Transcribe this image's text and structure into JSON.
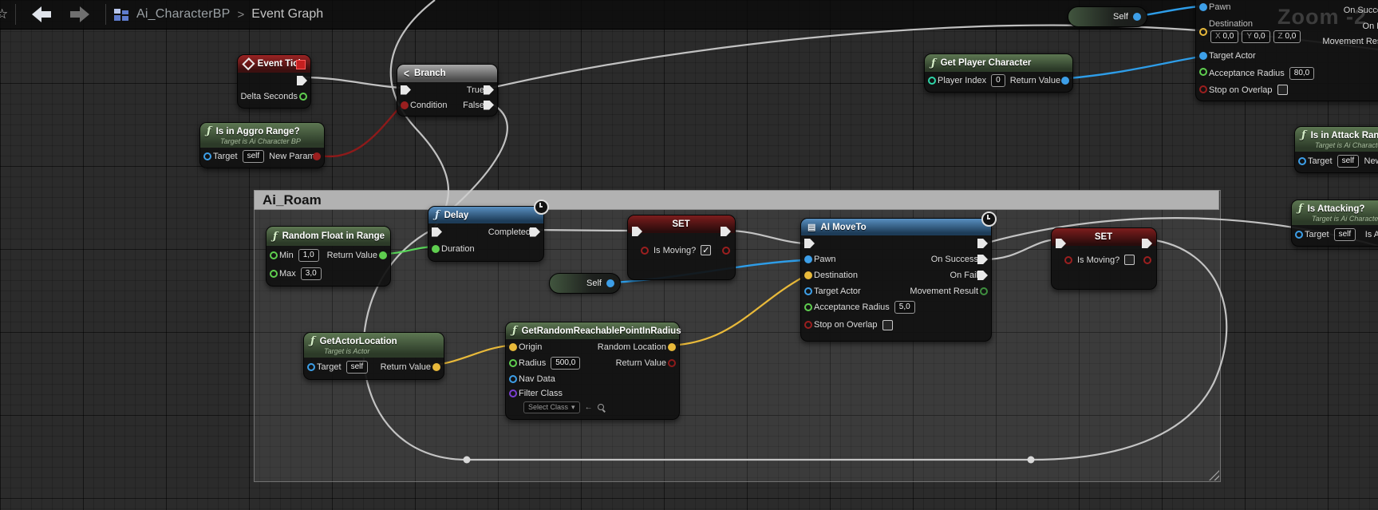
{
  "toolbar": {
    "breadcrumb": {
      "root": "Ai_CharacterBP",
      "sep": ">",
      "page": "Event Graph"
    }
  },
  "watermark": "Zoom -2",
  "comment": {
    "title": "Ai_Roam"
  },
  "pills": {
    "self_top": "Self",
    "self_mid": "Self"
  },
  "icons": {
    "fn": "ƒ",
    "grid": "▤",
    "branch": "<",
    "caret": "▾",
    "check": "✓",
    "back_arrow": "←",
    "star": "☆"
  },
  "nodes": {
    "event_tick": {
      "title": "Event Tick",
      "delta": "Delta Seconds"
    },
    "branch": {
      "title": "Branch",
      "condition": "Condition",
      "true_label": "True",
      "false_label": "False"
    },
    "aggro": {
      "title": "Is in Aggro Range?",
      "subtitle": "Target is Ai Character BP",
      "target": "Target",
      "target_value": "self",
      "out": "New Param"
    },
    "gpc": {
      "title": "Get Player Character",
      "index": "Player Index",
      "index_value": "0",
      "ret": "Return Value"
    },
    "random_float": {
      "title": "Random Float in Range",
      "min": "Min",
      "min_value": "1,0",
      "max": "Max",
      "max_value": "3,0",
      "ret": "Return Value"
    },
    "delay": {
      "title": "Delay",
      "completed": "Completed",
      "duration": "Duration"
    },
    "set1": {
      "title": "SET",
      "var": "Is Moving?",
      "checked": true
    },
    "ai_moveto": {
      "title": "AI MoveTo",
      "pawn": "Pawn",
      "destination": "Destination",
      "target_actor": "Target Actor",
      "acceptance": "Acceptance Radius",
      "acceptance_value": "5,0",
      "stop": "Stop on Overlap",
      "on_success": "On Success",
      "on_fail": "On Fail",
      "movement_result": "Movement Result"
    },
    "gal": {
      "title": "GetActorLocation",
      "subtitle": "Target is Actor",
      "target": "Target",
      "target_value": "self",
      "ret": "Return Value"
    },
    "grr": {
      "title": "GetRandomReachablePointInRadius",
      "origin": "Origin",
      "radius": "Radius",
      "radius_value": "500,0",
      "nav": "Nav Data",
      "filter": "Filter Class",
      "select": "Select Class",
      "random_location": "Random Location",
      "ret": "Return Value"
    },
    "set2": {
      "title": "SET",
      "var": "Is Moving?",
      "checked": false
    },
    "attack": {
      "title": "Is in Attack Range?",
      "subtitle": "Target is Ai Character BP",
      "target": "Target",
      "target_value": "self",
      "out": "New Param"
    },
    "attacking": {
      "title": "Is Attacking?",
      "subtitle": "Target is Ai Character BP",
      "target": "Target",
      "target_value": "self",
      "out": "Is Attacking"
    },
    "moveto2": {
      "pawn": "Pawn",
      "destination": "Destination",
      "x": "X",
      "x_value": "0,0",
      "y": "Y",
      "y_value": "0,0",
      "z": "Z",
      "z_value": "0,0",
      "target_actor": "Target Actor",
      "acceptance": "Acceptance Radius",
      "acceptance_value": "80,0",
      "stop": "Stop on Overlap",
      "on_success": "On Success",
      "on_fail": "On Fail",
      "movement_result": "Movement Result"
    }
  },
  "colors": {
    "exec": "#e8e8e8",
    "bool": "#9b1f1f",
    "float": "#5fce4f",
    "object": "#3d9fe8",
    "vector": "#e8b93a",
    "class": "#7a3fd1",
    "int": "#2fd5a8",
    "wire_white": "#cfcfcf",
    "enum": "#3f8f3f"
  }
}
